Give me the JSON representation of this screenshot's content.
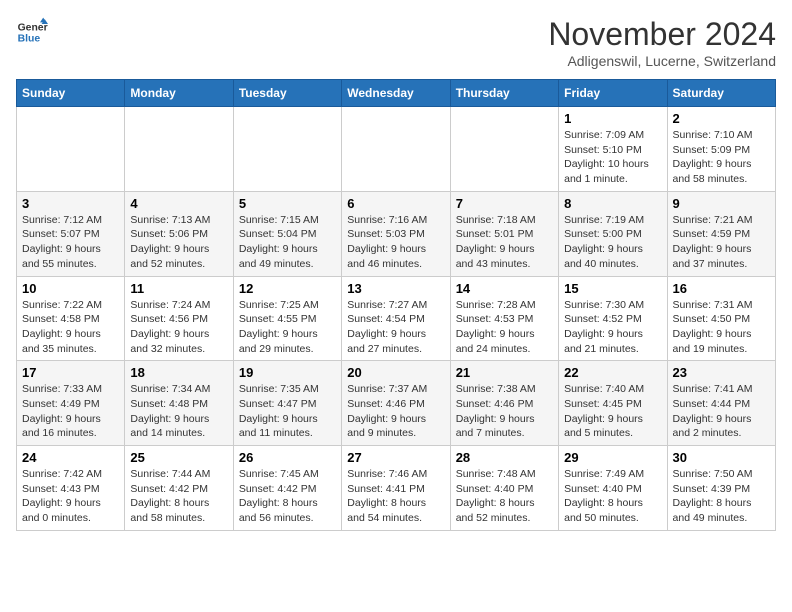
{
  "logo": {
    "line1": "General",
    "line2": "Blue"
  },
  "title": "November 2024",
  "subtitle": "Adligenswil, Lucerne, Switzerland",
  "weekdays": [
    "Sunday",
    "Monday",
    "Tuesday",
    "Wednesday",
    "Thursday",
    "Friday",
    "Saturday"
  ],
  "weeks": [
    [
      {
        "day": "",
        "detail": ""
      },
      {
        "day": "",
        "detail": ""
      },
      {
        "day": "",
        "detail": ""
      },
      {
        "day": "",
        "detail": ""
      },
      {
        "day": "",
        "detail": ""
      },
      {
        "day": "1",
        "detail": "Sunrise: 7:09 AM\nSunset: 5:10 PM\nDaylight: 10 hours and 1 minute."
      },
      {
        "day": "2",
        "detail": "Sunrise: 7:10 AM\nSunset: 5:09 PM\nDaylight: 9 hours and 58 minutes."
      }
    ],
    [
      {
        "day": "3",
        "detail": "Sunrise: 7:12 AM\nSunset: 5:07 PM\nDaylight: 9 hours and 55 minutes."
      },
      {
        "day": "4",
        "detail": "Sunrise: 7:13 AM\nSunset: 5:06 PM\nDaylight: 9 hours and 52 minutes."
      },
      {
        "day": "5",
        "detail": "Sunrise: 7:15 AM\nSunset: 5:04 PM\nDaylight: 9 hours and 49 minutes."
      },
      {
        "day": "6",
        "detail": "Sunrise: 7:16 AM\nSunset: 5:03 PM\nDaylight: 9 hours and 46 minutes."
      },
      {
        "day": "7",
        "detail": "Sunrise: 7:18 AM\nSunset: 5:01 PM\nDaylight: 9 hours and 43 minutes."
      },
      {
        "day": "8",
        "detail": "Sunrise: 7:19 AM\nSunset: 5:00 PM\nDaylight: 9 hours and 40 minutes."
      },
      {
        "day": "9",
        "detail": "Sunrise: 7:21 AM\nSunset: 4:59 PM\nDaylight: 9 hours and 37 minutes."
      }
    ],
    [
      {
        "day": "10",
        "detail": "Sunrise: 7:22 AM\nSunset: 4:58 PM\nDaylight: 9 hours and 35 minutes."
      },
      {
        "day": "11",
        "detail": "Sunrise: 7:24 AM\nSunset: 4:56 PM\nDaylight: 9 hours and 32 minutes."
      },
      {
        "day": "12",
        "detail": "Sunrise: 7:25 AM\nSunset: 4:55 PM\nDaylight: 9 hours and 29 minutes."
      },
      {
        "day": "13",
        "detail": "Sunrise: 7:27 AM\nSunset: 4:54 PM\nDaylight: 9 hours and 27 minutes."
      },
      {
        "day": "14",
        "detail": "Sunrise: 7:28 AM\nSunset: 4:53 PM\nDaylight: 9 hours and 24 minutes."
      },
      {
        "day": "15",
        "detail": "Sunrise: 7:30 AM\nSunset: 4:52 PM\nDaylight: 9 hours and 21 minutes."
      },
      {
        "day": "16",
        "detail": "Sunrise: 7:31 AM\nSunset: 4:50 PM\nDaylight: 9 hours and 19 minutes."
      }
    ],
    [
      {
        "day": "17",
        "detail": "Sunrise: 7:33 AM\nSunset: 4:49 PM\nDaylight: 9 hours and 16 minutes."
      },
      {
        "day": "18",
        "detail": "Sunrise: 7:34 AM\nSunset: 4:48 PM\nDaylight: 9 hours and 14 minutes."
      },
      {
        "day": "19",
        "detail": "Sunrise: 7:35 AM\nSunset: 4:47 PM\nDaylight: 9 hours and 11 minutes."
      },
      {
        "day": "20",
        "detail": "Sunrise: 7:37 AM\nSunset: 4:46 PM\nDaylight: 9 hours and 9 minutes."
      },
      {
        "day": "21",
        "detail": "Sunrise: 7:38 AM\nSunset: 4:46 PM\nDaylight: 9 hours and 7 minutes."
      },
      {
        "day": "22",
        "detail": "Sunrise: 7:40 AM\nSunset: 4:45 PM\nDaylight: 9 hours and 5 minutes."
      },
      {
        "day": "23",
        "detail": "Sunrise: 7:41 AM\nSunset: 4:44 PM\nDaylight: 9 hours and 2 minutes."
      }
    ],
    [
      {
        "day": "24",
        "detail": "Sunrise: 7:42 AM\nSunset: 4:43 PM\nDaylight: 9 hours and 0 minutes."
      },
      {
        "day": "25",
        "detail": "Sunrise: 7:44 AM\nSunset: 4:42 PM\nDaylight: 8 hours and 58 minutes."
      },
      {
        "day": "26",
        "detail": "Sunrise: 7:45 AM\nSunset: 4:42 PM\nDaylight: 8 hours and 56 minutes."
      },
      {
        "day": "27",
        "detail": "Sunrise: 7:46 AM\nSunset: 4:41 PM\nDaylight: 8 hours and 54 minutes."
      },
      {
        "day": "28",
        "detail": "Sunrise: 7:48 AM\nSunset: 4:40 PM\nDaylight: 8 hours and 52 minutes."
      },
      {
        "day": "29",
        "detail": "Sunrise: 7:49 AM\nSunset: 4:40 PM\nDaylight: 8 hours and 50 minutes."
      },
      {
        "day": "30",
        "detail": "Sunrise: 7:50 AM\nSunset: 4:39 PM\nDaylight: 8 hours and 49 minutes."
      }
    ]
  ]
}
